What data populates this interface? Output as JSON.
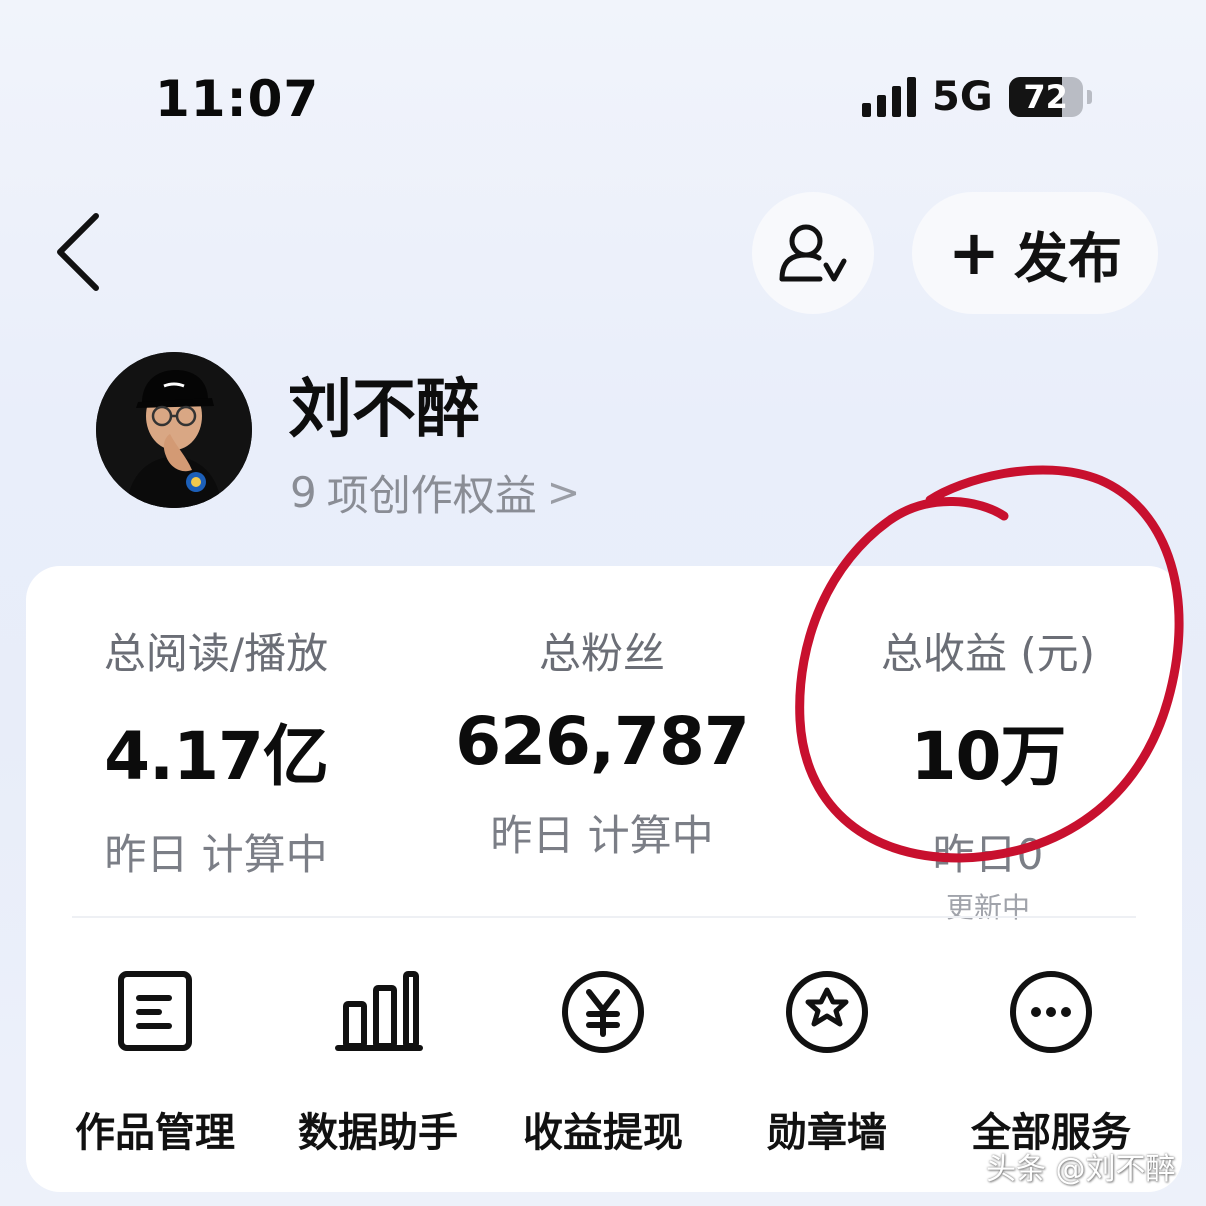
{
  "status_bar": {
    "time": "11:07",
    "network": "5G",
    "battery_level": "72",
    "battery_fraction": 0.72
  },
  "header": {
    "back_icon": "chevron-left-icon",
    "user_check_icon": "user-check-icon",
    "publish_plus": "+",
    "publish_label": "发布"
  },
  "profile": {
    "name": "刘不醉",
    "rights_count": "9",
    "rights_label": "项创作权益",
    "rights_chevron": ">"
  },
  "stats": [
    {
      "title": "总阅读/播放",
      "value": "4.17亿",
      "sub": "昨日 计算中"
    },
    {
      "title": "总粉丝",
      "value": "626,787",
      "sub": "昨日 计算中"
    },
    {
      "title": "总收益 (元)",
      "value": "10万",
      "sub": "昨日0",
      "sub2": "更新中"
    }
  ],
  "services": [
    {
      "label": "作品管理",
      "icon": "document-icon"
    },
    {
      "label": "数据助手",
      "icon": "bar-chart-icon"
    },
    {
      "label": "收益提现",
      "icon": "yen-circle-icon"
    },
    {
      "label": "勋章墙",
      "icon": "medal-star-icon"
    },
    {
      "label": "全部服务",
      "icon": "more-circle-icon"
    }
  ],
  "annotation": {
    "color": "#c8102e"
  },
  "watermark": "头条 @刘不醉"
}
